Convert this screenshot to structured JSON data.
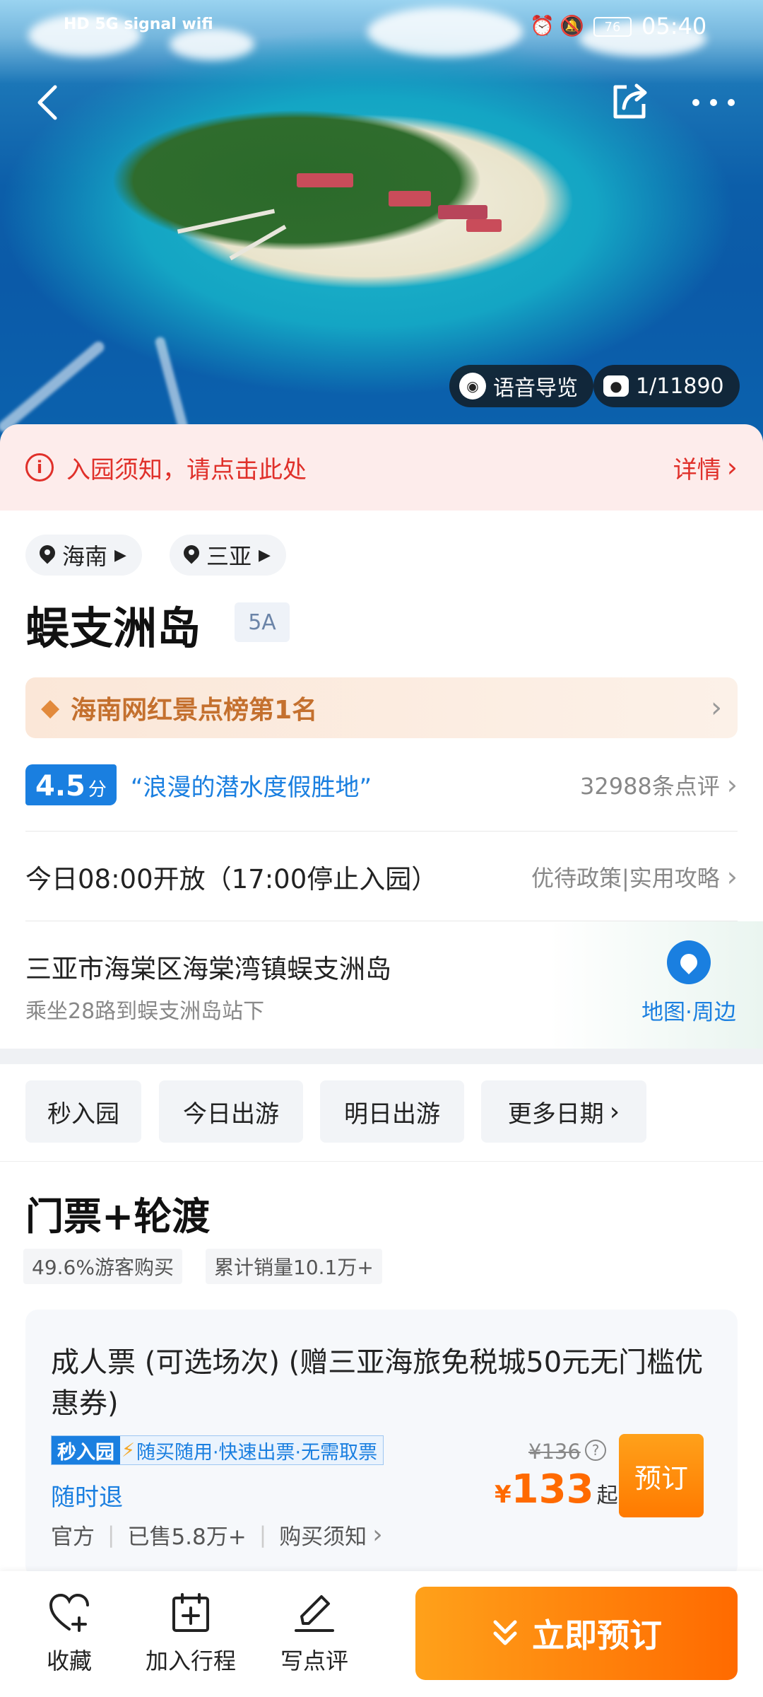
{
  "status_bar": {
    "left_icons": "HD 5G signal wifi",
    "battery": "76",
    "time": "05:40"
  },
  "hero": {
    "audio_guide_label": "语音导览",
    "photo_counter": "1/11890"
  },
  "notice": {
    "text": "入园须知，请点击此处",
    "detail_label": "详情"
  },
  "locations": [
    {
      "label": "海南"
    },
    {
      "label": "三亚"
    }
  ],
  "attraction": {
    "name": "蜈支洲岛",
    "grade": "5A"
  },
  "rank": {
    "text": "海南网红景点榜第1名"
  },
  "rating": {
    "score": "4.5",
    "unit": "分",
    "quote": "“浪漫的潜水度假胜地”",
    "review_count": "32988条点评"
  },
  "hours": {
    "text": "今日08:00开放（17:00停止入园）",
    "links": "优待政策|实用攻略"
  },
  "address": {
    "line": "三亚市海棠区海棠湾镇蜈支洲岛",
    "transit": "乘坐28路到蜈支洲岛站下",
    "map_label": "地图·周边"
  },
  "date_filters": [
    {
      "label": "秒入园"
    },
    {
      "label": "今日出游"
    },
    {
      "label": "明日出游"
    },
    {
      "label": "更多日期"
    }
  ],
  "section": {
    "title": "门票+轮渡",
    "tag1": "49.6%游客购买",
    "tag2": "累计销量10.1万+"
  },
  "ticket": {
    "title": "成人票 (可选场次) (赠三亚海旅免税城50元无门槛优惠券)",
    "badge_fast": "秒入园",
    "badge_features": "随买随用·快速出票·无需取票",
    "refund": "随时退",
    "official": "官方",
    "sold": "已售5.8万+",
    "notice": "购买须知",
    "original_price": "¥136",
    "currency": "¥",
    "price": "133",
    "price_suffix": "起",
    "book_label": "预订"
  },
  "bottom_bar": {
    "favorite": "收藏",
    "add_trip": "加入行程",
    "review": "写点评",
    "book_now": "立即预订"
  },
  "colors": {
    "accent_blue": "#1a7fe0",
    "price_orange": "#ff6a00",
    "notice_red": "#e0302a",
    "rank_brown": "#c4702e"
  }
}
